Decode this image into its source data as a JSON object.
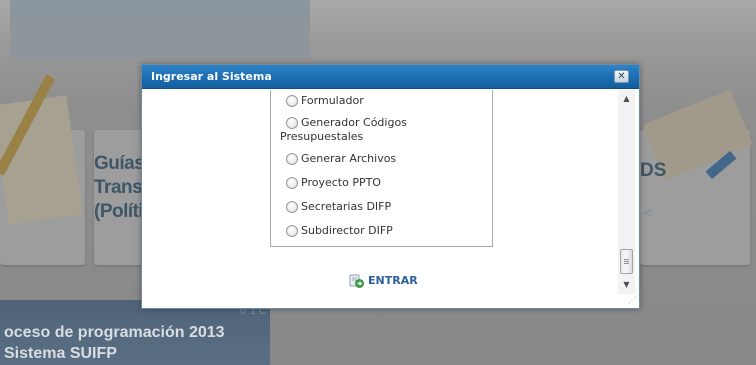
{
  "background": {
    "card_heading_lines": [
      "Guías",
      "Transv",
      "(Políti"
    ],
    "right_card_letters": "DS",
    "right_card_marker": "<",
    "bottom_lines": [
      "oceso de programación 2013",
      "Sistema SUIFP"
    ],
    "bottom_number": "0 1 C"
  },
  "dialog": {
    "title": "Ingresar al Sistema",
    "close_symbol": "✕",
    "roles": [
      {
        "label": "Formulador",
        "selected": false
      },
      {
        "label": "Generador Códigos",
        "label_line2": "Presupuestales",
        "selected": false
      },
      {
        "label": "Generar Archivos",
        "selected": false
      },
      {
        "label": "Proyecto PPTO",
        "selected": false
      },
      {
        "label": "Secretarias DIFP",
        "selected": false
      },
      {
        "label": "Subdirector DIFP",
        "selected": false
      }
    ],
    "enter_label": "ENTRAR",
    "scroll_up_symbol": "▲",
    "scroll_down_symbol": "▼",
    "resize_symbol": "⋰"
  },
  "colors": {
    "titlebar": "#1c6eb3",
    "enter_text": "#2d5f9a",
    "overlay": "#8d8d8d"
  }
}
